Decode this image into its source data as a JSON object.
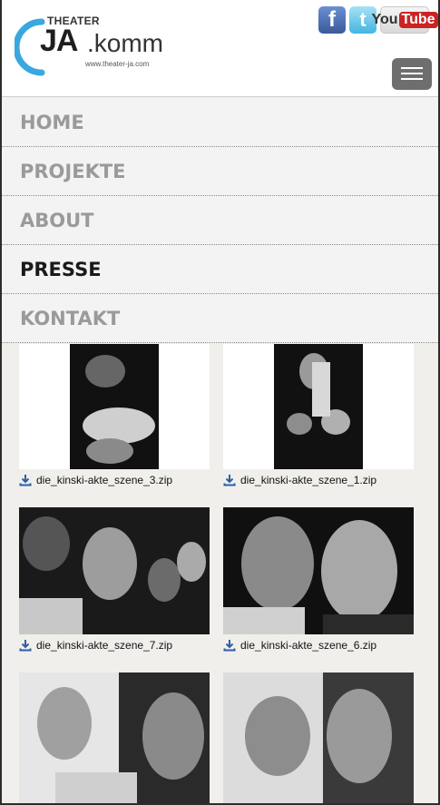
{
  "header": {
    "logo": {
      "theater": "THEATER",
      "ja": "JA",
      "komm": ".komm",
      "url": "www.theater-ja.com"
    },
    "social": {
      "facebook_glyph": "f",
      "twitter_glyph": "t",
      "youtube_you": "You",
      "youtube_tube": "Tube"
    },
    "menu_icon": "hamburger-icon"
  },
  "nav": {
    "items": [
      {
        "label": "HOME",
        "active": false
      },
      {
        "label": "PROJEKTE",
        "active": false
      },
      {
        "label": "ABOUT",
        "active": false
      },
      {
        "label": "PRESSE",
        "active": true
      },
      {
        "label": "KONTAKT",
        "active": false
      }
    ]
  },
  "downloads": {
    "icon": "download-icon",
    "files": [
      {
        "name": "die_kinski-akte_szene_3.zip"
      },
      {
        "name": "die_kinski-akte_szene_1.zip"
      },
      {
        "name": "die_kinski-akte_szene_7.zip"
      },
      {
        "name": "die_kinski-akte_szene_6.zip"
      },
      {
        "name": ""
      },
      {
        "name": ""
      }
    ]
  },
  "colors": {
    "accent_blue": "#3aa7e0",
    "nav_active": "#1a1a1a",
    "nav_inactive": "#9a9a9a",
    "menu_button": "#6e6e6e"
  }
}
